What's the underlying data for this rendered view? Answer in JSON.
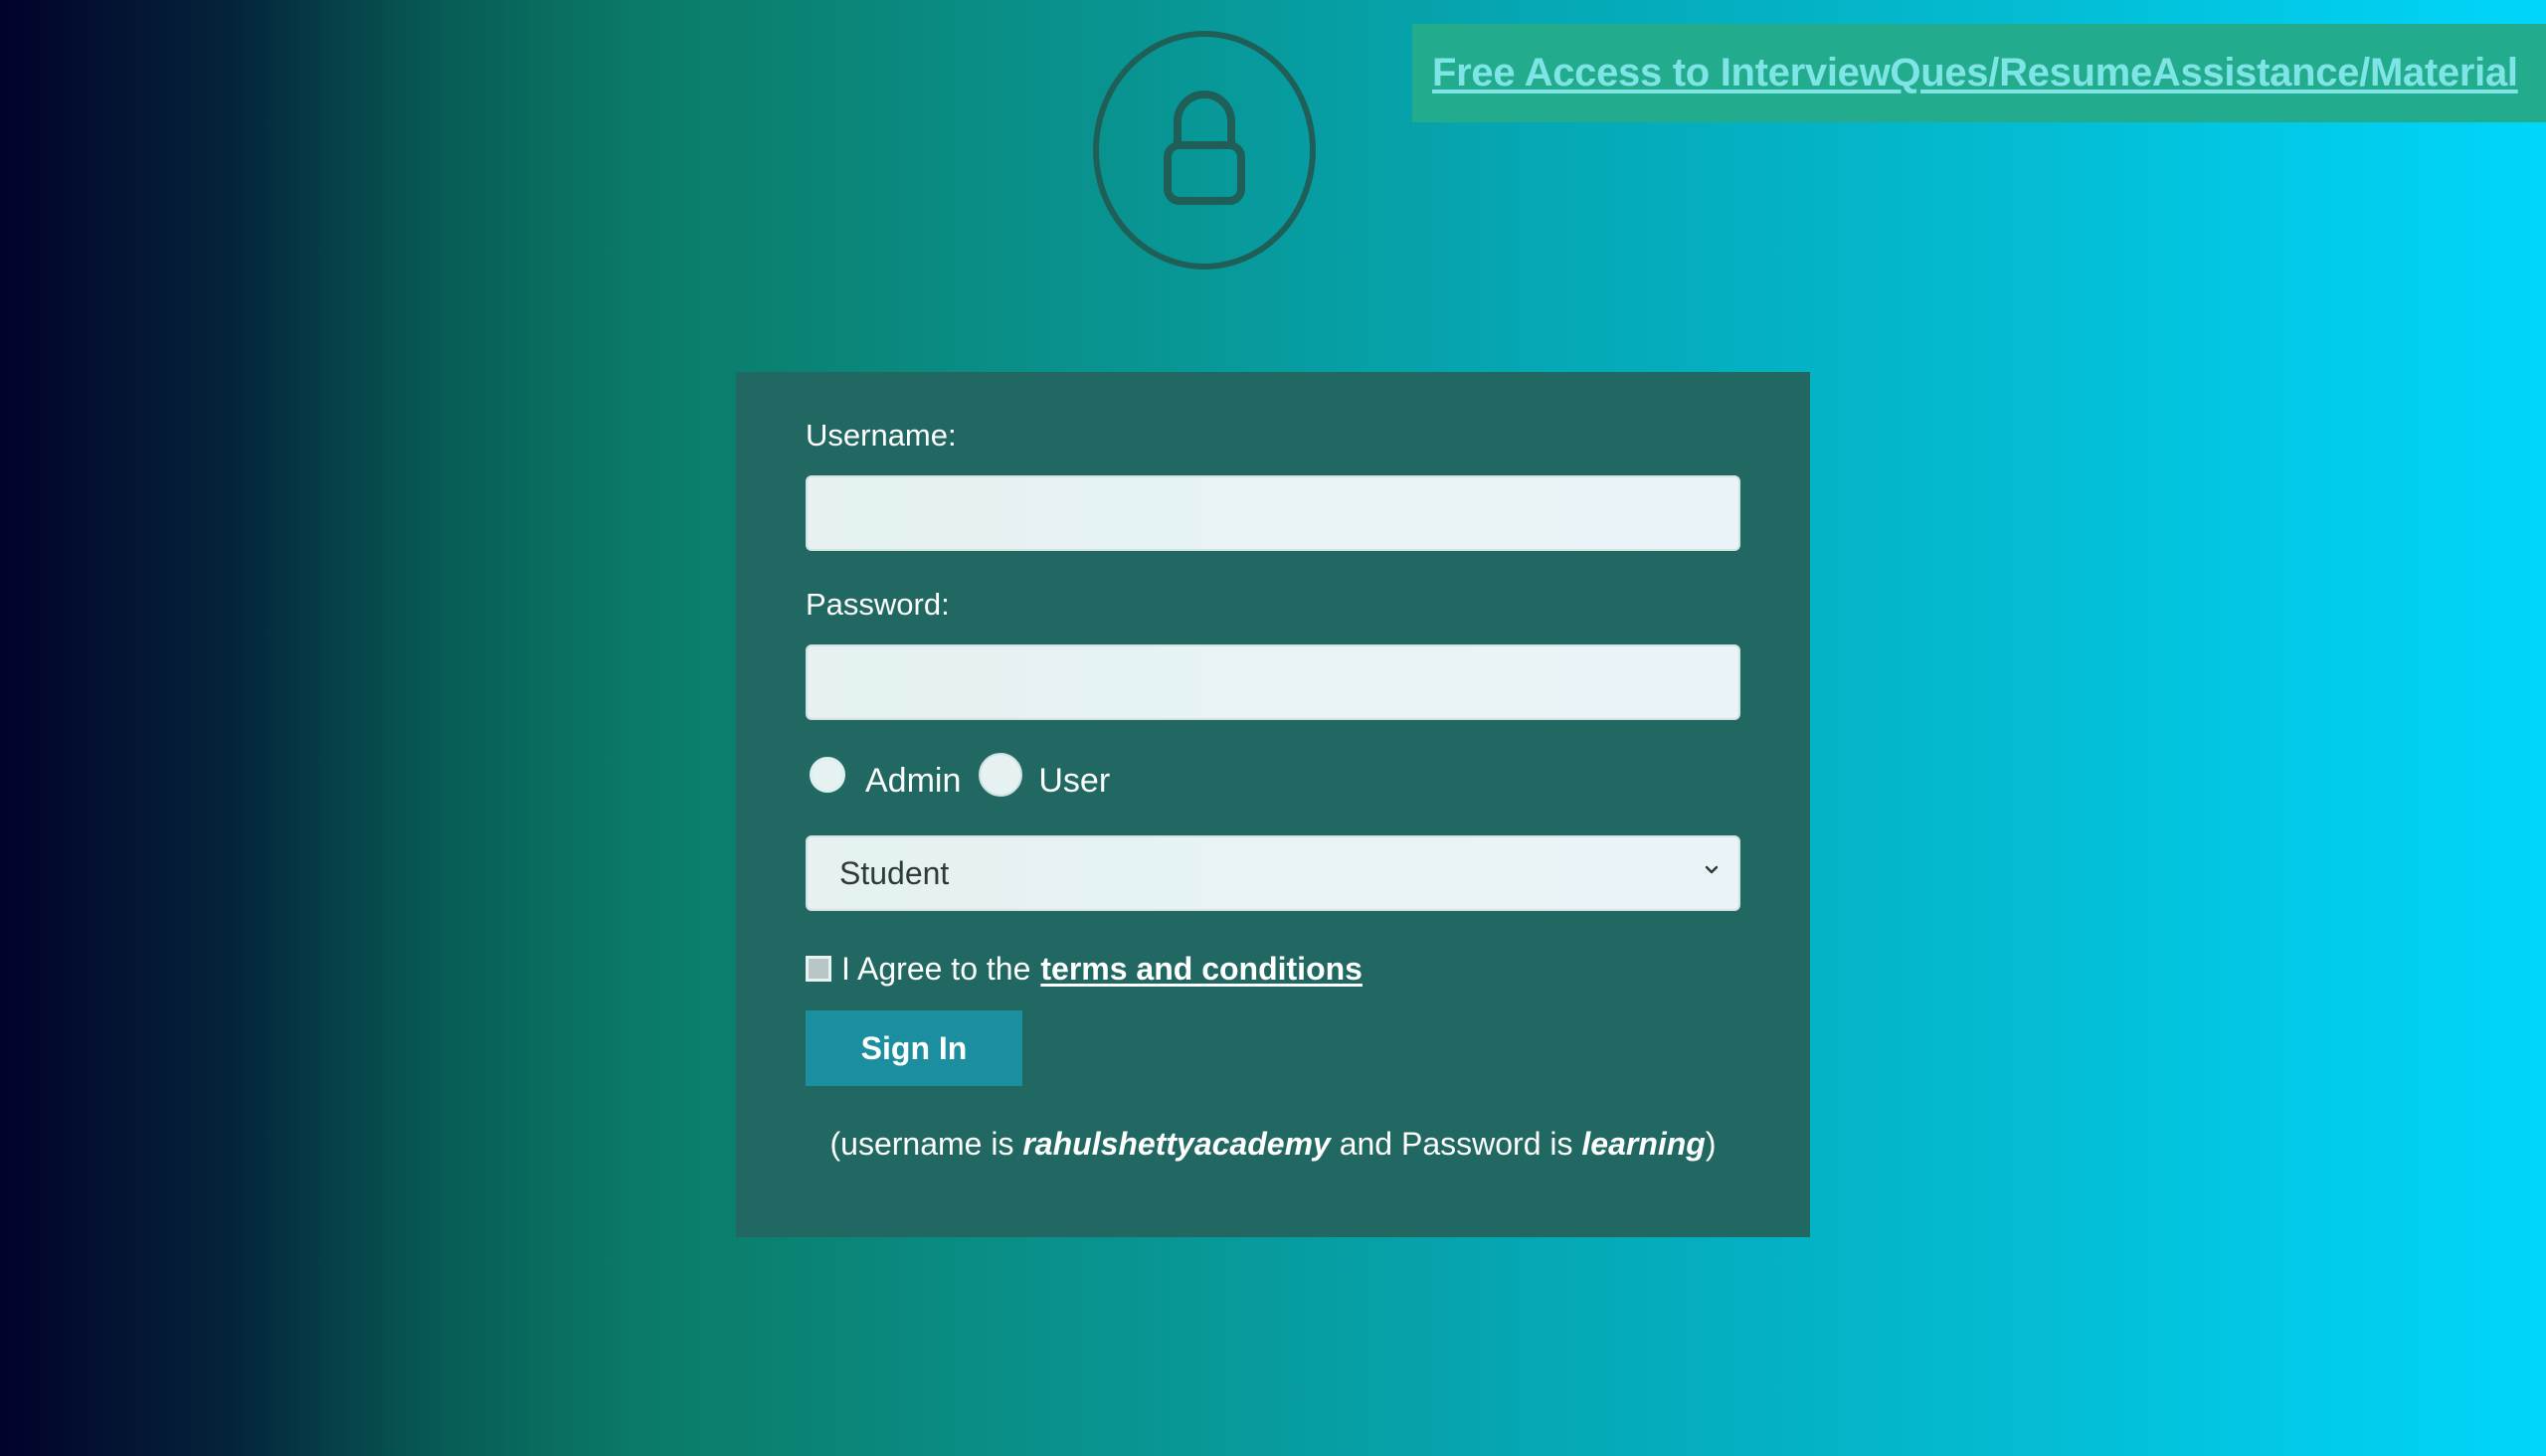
{
  "banner": {
    "link_text": "Free Access to InterviewQues/ResumeAssistance/Material"
  },
  "lock": {
    "icon": "lock-icon",
    "color": "#1f5f58"
  },
  "form": {
    "username_label": "Username:",
    "username_value": "",
    "password_label": "Password:",
    "password_value": "",
    "radio_options": [
      {
        "label": "Admin",
        "selected": true
      },
      {
        "label": "User",
        "selected": false
      }
    ],
    "select_value": "Student",
    "agree_prefix": "I Agree to the",
    "terms_link": "terms and conditions",
    "agree_checked": false,
    "signin_label": "Sign In",
    "hint": {
      "open": "(username is",
      "username": "rahulshettyacademy",
      "middle": "and Password is",
      "password": "learning",
      "close": ")"
    }
  },
  "colors": {
    "card_bg": "#206861",
    "banner_bg": "#22ab8c",
    "banner_link": "#7ee4e6",
    "button_bg": "#1b8ea0"
  }
}
